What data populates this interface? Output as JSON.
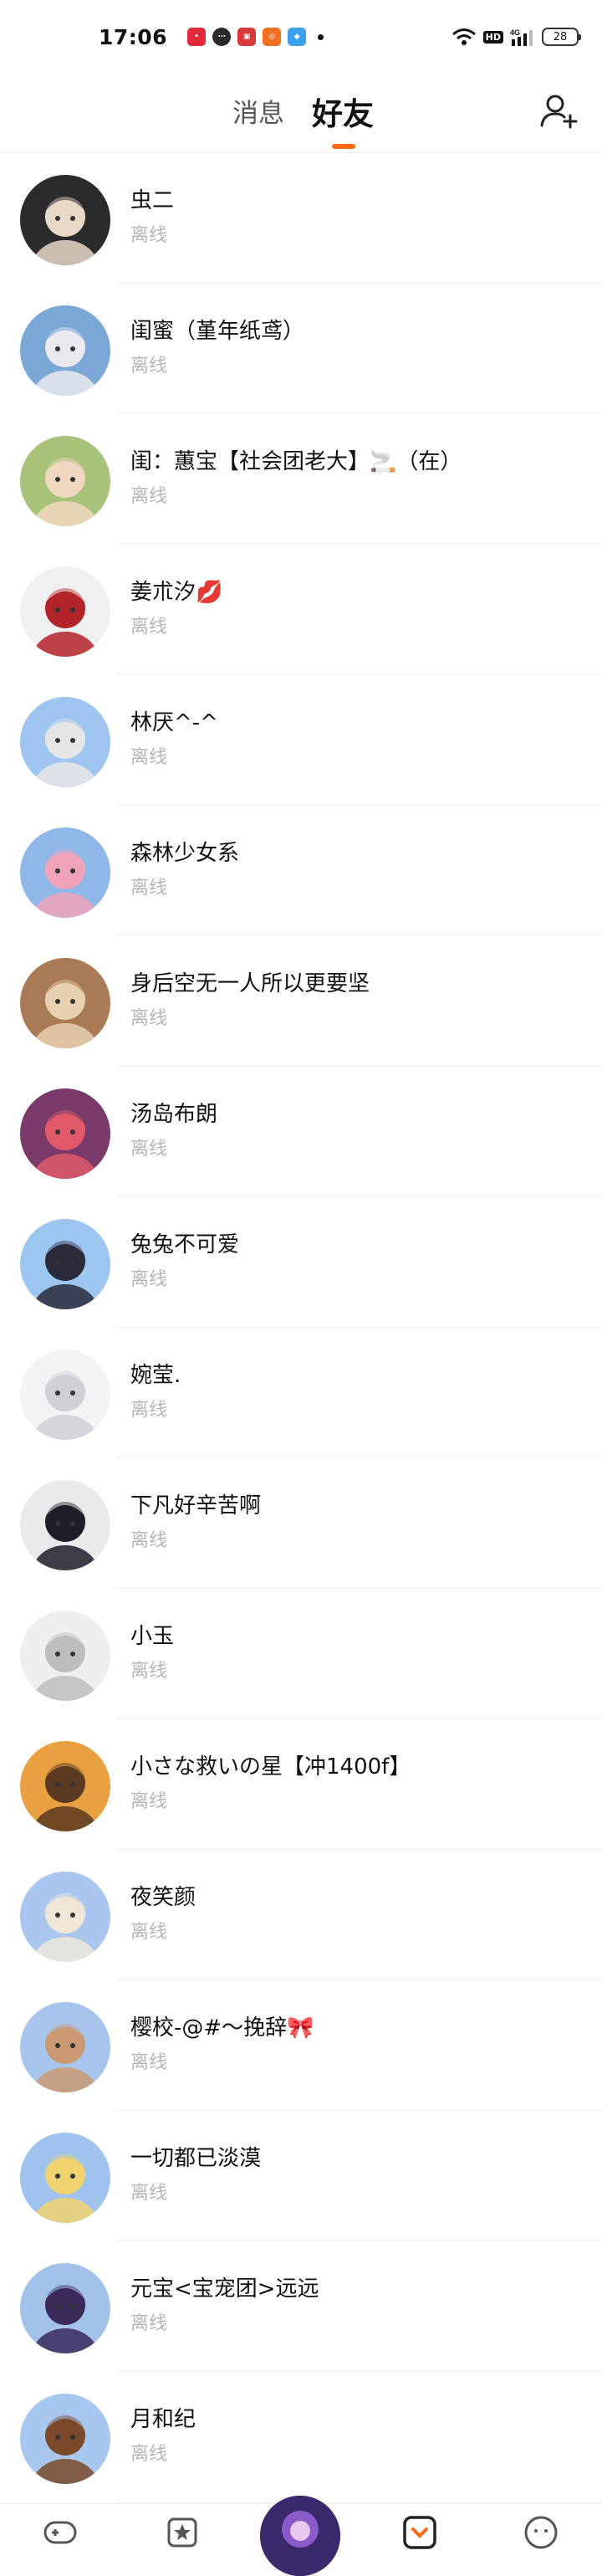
{
  "status_bar": {
    "time": "17:06",
    "battery": "28",
    "hd": "HD",
    "network": "4G"
  },
  "tabs": [
    {
      "label": "消息",
      "active": false
    },
    {
      "label": "好友",
      "active": true
    }
  ],
  "header": {
    "add_friend_icon": "add-user-icon"
  },
  "friends": [
    {
      "name": "虫二",
      "status": "离线",
      "avatar_bg": "#2b2b2b",
      "avatar_fg": "#e8d8c8"
    },
    {
      "name": "闺蜜（堇年纸鸢）",
      "status": "离线",
      "avatar_bg": "#7aa7d6",
      "avatar_fg": "#e9e9ef"
    },
    {
      "name": "闺：蕙宝【社会团老大】🚬（在）",
      "status": "离线",
      "avatar_bg": "#a8c27a",
      "avatar_fg": "#f1d8c0"
    },
    {
      "name": "姜朮汐💋",
      "status": "离线",
      "avatar_bg": "#f0f0f0",
      "avatar_fg": "#b3232a"
    },
    {
      "name": "林厌^-^",
      "status": "离线",
      "avatar_bg": "#9ec5f0",
      "avatar_fg": "#e6e6e6"
    },
    {
      "name": "森林少女系",
      "status": "离线",
      "avatar_bg": "#8fb8e8",
      "avatar_fg": "#f0a3b8"
    },
    {
      "name": "身后空无一人所以更要坚",
      "status": "离线",
      "avatar_bg": "#a87a55",
      "avatar_fg": "#e8d0b0"
    },
    {
      "name": "汤岛布朗",
      "status": "离线",
      "avatar_bg": "#7a3a6a",
      "avatar_fg": "#e05a6a"
    },
    {
      "name": "兔兔不可爱",
      "status": "离线",
      "avatar_bg": "#9cc6f0",
      "avatar_fg": "#2a2a3a"
    },
    {
      "name": "婉莹.",
      "status": "离线",
      "avatar_bg": "#f3f3f3",
      "avatar_fg": "#cfcfd6"
    },
    {
      "name": "下凡好辛苦啊",
      "status": "离线",
      "avatar_bg": "#eaeaea",
      "avatar_fg": "#1f1f2a"
    },
    {
      "name": "小玉",
      "status": "离线",
      "avatar_bg": "#efefef",
      "avatar_fg": "#bdbdbd"
    },
    {
      "name": "小さな救いの星【冲1400f】",
      "status": "离线",
      "avatar_bg": "#e8a040",
      "avatar_fg": "#5a3a20"
    },
    {
      "name": "夜笑颜",
      "status": "离线",
      "avatar_bg": "#a9c6ee",
      "avatar_fg": "#efe6d8"
    },
    {
      "name": "樱校-@#～挽辞🎀",
      "status": "离线",
      "avatar_bg": "#a6c4ec",
      "avatar_fg": "#c99a72"
    },
    {
      "name": "一切都已淡漠",
      "status": "离线",
      "avatar_bg": "#9fc3ec",
      "avatar_fg": "#f0d270"
    },
    {
      "name": "元宝<宝宠团>远远",
      "status": "离线",
      "avatar_bg": "#a2c2ea",
      "avatar_fg": "#3a2a5a"
    },
    {
      "name": "月和纪",
      "status": "离线",
      "avatar_bg": "#a7c7ef",
      "avatar_fg": "#7a4a2a"
    }
  ],
  "bottom_nav": {
    "items": [
      {
        "icon": "gamepad-icon"
      },
      {
        "icon": "star-icon"
      },
      {
        "icon": "center-avatar-icon"
      },
      {
        "icon": "friends-icon",
        "active": true
      },
      {
        "icon": "face-icon"
      }
    ],
    "accent": "#ff6a13"
  }
}
